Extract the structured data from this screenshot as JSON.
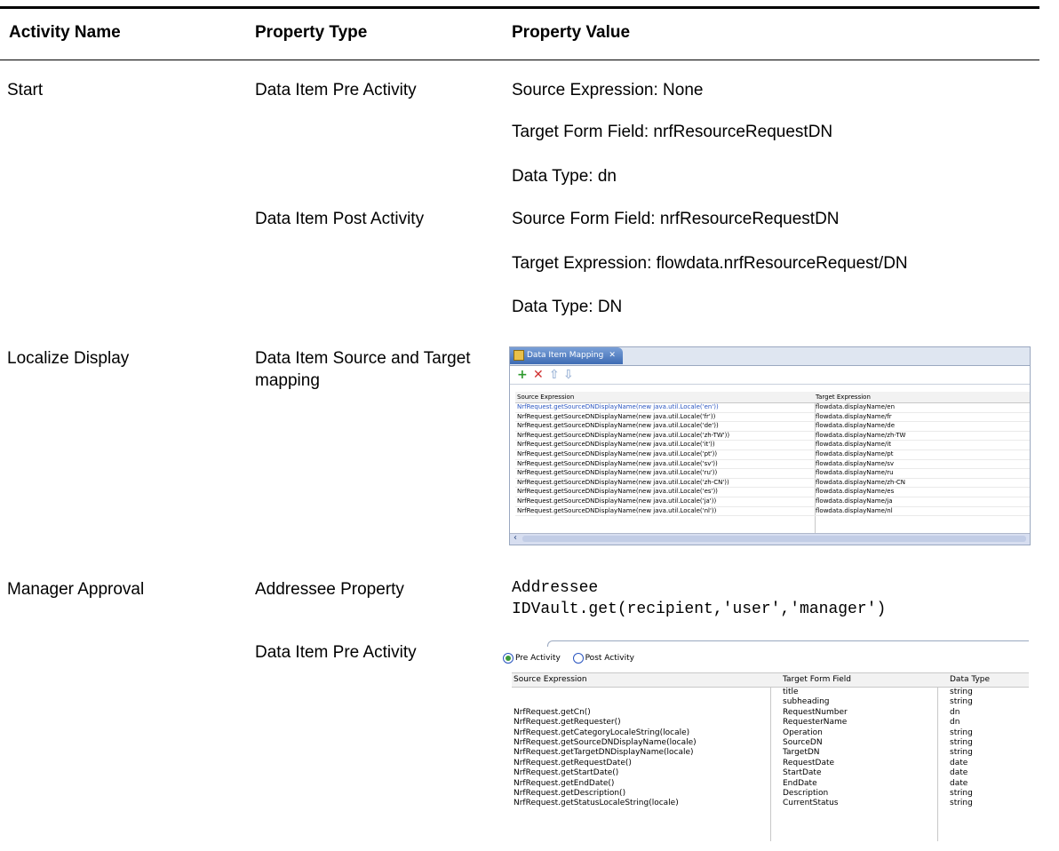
{
  "headers": {
    "activity": "Activity Name",
    "type": "Property Type",
    "value": "Property Value"
  },
  "rows": {
    "start": {
      "activity": "Start",
      "pre_type": "Data Item Pre Activity",
      "pre_values": [
        "Source Expression: None",
        "Target Form Field: nrfResourceRequestDN",
        "Data Type: dn"
      ],
      "post_type": "Data Item Post Activity",
      "post_values": [
        "Source Form Field: nrfResourceRequestDN",
        "Target Expression: flowdata.nrfResourceRequest/DN",
        "Data Type: DN"
      ]
    },
    "localize": {
      "activity": "Localize Display",
      "type": "Data Item Source and Target mapping"
    },
    "manager": {
      "activity": "Manager Approval",
      "addressee_type": "Addressee Property",
      "addressee_value_line1": "Addressee",
      "addressee_value_line2": "IDVault.get(recipient,'user','manager')",
      "pre_type": "Data Item Pre Activity"
    }
  },
  "mapping_editor": {
    "tab_label": "Data Item Mapping",
    "toolbar": {
      "add_icon": "plus-icon",
      "delete_icon": "x-icon",
      "up_icon": "arrow-up-icon",
      "down_icon": "arrow-down-icon"
    },
    "columns": [
      "Source Expression",
      "Target Expression"
    ],
    "rows": [
      [
        "NrfRequest.getSourceDNDisplayName(new java.util.Locale('en'))",
        "flowdata.displayName/en"
      ],
      [
        "NrfRequest.getSourceDNDisplayName(new java.util.Locale('fr'))",
        "flowdata.displayName/fr"
      ],
      [
        "NrfRequest.getSourceDNDisplayName(new java.util.Locale('de'))",
        "flowdata.displayName/de"
      ],
      [
        "NrfRequest.getSourceDNDisplayName(new java.util.Locale('zh-TW'))",
        "flowdata.displayName/zh-TW"
      ],
      [
        "NrfRequest.getSourceDNDisplayName(new java.util.Locale('it'))",
        "flowdata.displayName/it"
      ],
      [
        "NrfRequest.getSourceDNDisplayName(new java.util.Locale('pt'))",
        "flowdata.displayName/pt"
      ],
      [
        "NrfRequest.getSourceDNDisplayName(new java.util.Locale('sv'))",
        "flowdata.displayName/sv"
      ],
      [
        "NrfRequest.getSourceDNDisplayName(new java.util.Locale('ru'))",
        "flowdata.displayName/ru"
      ],
      [
        "NrfRequest.getSourceDNDisplayName(new java.util.Locale('zh-CN'))",
        "flowdata.displayName/zh-CN"
      ],
      [
        "NrfRequest.getSourceDNDisplayName(new java.util.Locale('es'))",
        "flowdata.displayName/es"
      ],
      [
        "NrfRequest.getSourceDNDisplayName(new java.util.Locale('ja'))",
        "flowdata.displayName/ja"
      ],
      [
        "NrfRequest.getSourceDNDisplayName(new java.util.Locale('nl'))",
        "flowdata.displayName/nl"
      ]
    ]
  },
  "pre_activity_table": {
    "radio_pre": "Pre Activity",
    "radio_post": "Post Activity",
    "selected": "Pre Activity",
    "columns": [
      "Source Expression",
      "Target Form Field",
      "Data Type"
    ],
    "rows": [
      [
        "",
        "title",
        "string"
      ],
      [
        "",
        "subheading",
        "string"
      ],
      [
        "NrfRequest.getCn()",
        "RequestNumber",
        "dn"
      ],
      [
        "NrfRequest.getRequester()",
        "RequesterName",
        "dn"
      ],
      [
        "NrfRequest.getCategoryLocaleString(locale)",
        "Operation",
        "string"
      ],
      [
        "NrfRequest.getSourceDNDisplayName(locale)",
        "SourceDN",
        "string"
      ],
      [
        "NrfRequest.getTargetDNDisplayName(locale)",
        "TargetDN",
        "string"
      ],
      [
        "NrfRequest.getRequestDate()",
        "RequestDate",
        "date"
      ],
      [
        "NrfRequest.getStartDate()",
        "StartDate",
        "date"
      ],
      [
        "NrfRequest.getEndDate()",
        "EndDate",
        "date"
      ],
      [
        "NrfRequest.getDescription()",
        "Description",
        "string"
      ],
      [
        "NrfRequest.getStatusLocaleString(locale)",
        "CurrentStatus",
        "string"
      ]
    ]
  }
}
